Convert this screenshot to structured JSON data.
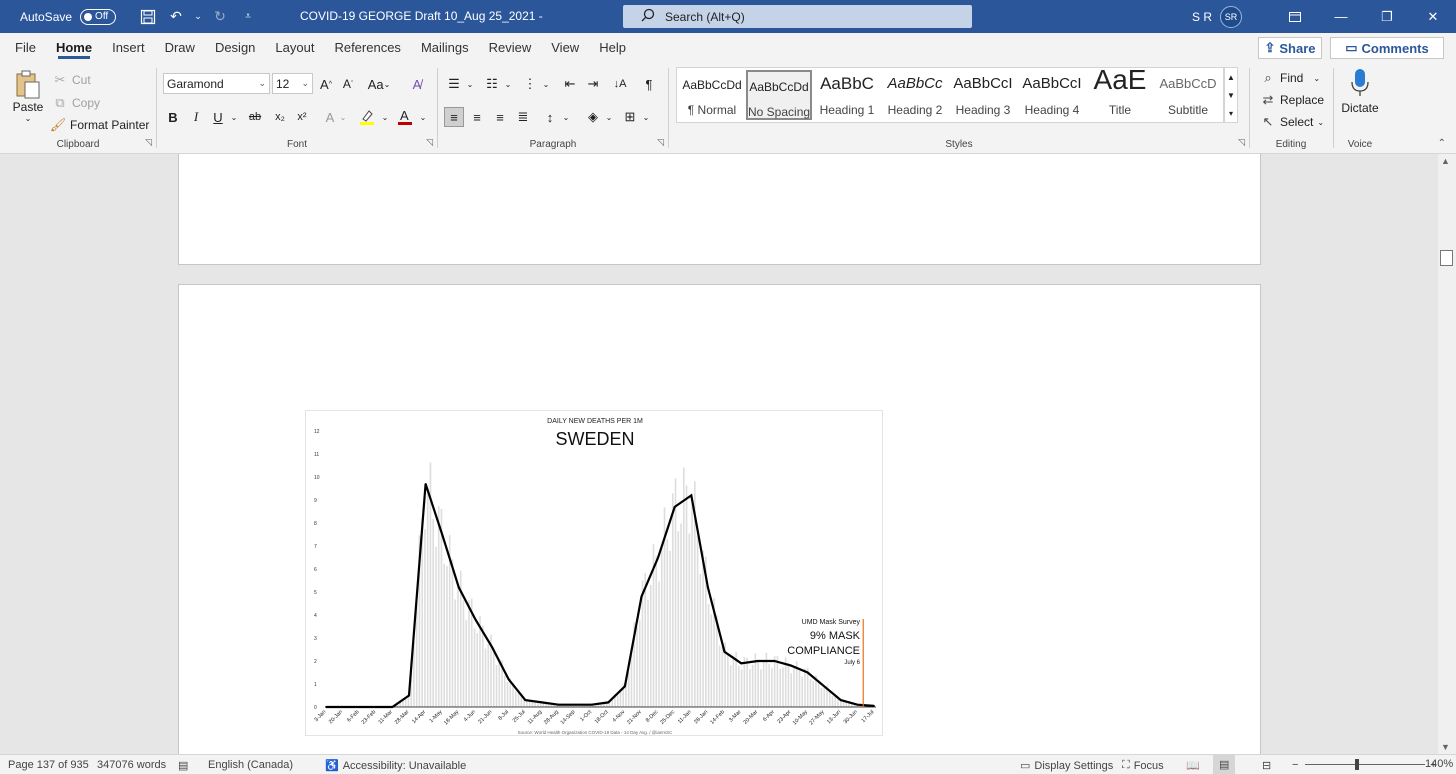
{
  "titlebar": {
    "autosave_label": "AutoSave",
    "autosave_state": "Off",
    "doc_title": "COVID-19 GEORGE Draft 10_Aug 25_2021  -  ",
    "search_placeholder": "Search (Alt+Q)",
    "user_initials_text": "S R",
    "avatar_text": "SR"
  },
  "tabs": [
    {
      "label": "File"
    },
    {
      "label": "Home"
    },
    {
      "label": "Insert"
    },
    {
      "label": "Draw"
    },
    {
      "label": "Design"
    },
    {
      "label": "Layout"
    },
    {
      "label": "References"
    },
    {
      "label": "Mailings"
    },
    {
      "label": "Review"
    },
    {
      "label": "View"
    },
    {
      "label": "Help"
    }
  ],
  "share_label": "Share",
  "comments_label": "Comments",
  "clipboard": {
    "paste": "Paste",
    "cut": "Cut",
    "copy": "Copy",
    "format_painter": "Format Painter",
    "group": "Clipboard"
  },
  "font": {
    "name": "Garamond",
    "size": "12",
    "group": "Font",
    "change_case": "Aa",
    "bold": "B",
    "italic": "I",
    "underline": "U",
    "strike": "ab",
    "subscript": "x₂",
    "superscript": "x²"
  },
  "paragraph": {
    "group": "Paragraph"
  },
  "styles": {
    "group": "Styles",
    "items": [
      {
        "preview": "AaBbCcDd",
        "name": "¶ Normal"
      },
      {
        "preview": "AaBbCcDd",
        "name": "No Spacing"
      },
      {
        "preview": "AaBbC",
        "name": "Heading 1"
      },
      {
        "preview": "AaBbCc",
        "name": "Heading 2"
      },
      {
        "preview": "AaBbCcI",
        "name": "Heading 3"
      },
      {
        "preview": "AaBbCcI",
        "name": "Heading 4"
      },
      {
        "preview": "AaE",
        "name": "Title"
      },
      {
        "preview": "AaBbCcD",
        "name": "Subtitle"
      }
    ]
  },
  "editing": {
    "find": "Find",
    "replace": "Replace",
    "select": "Select",
    "group": "Editing"
  },
  "voice": {
    "dictate": "Dictate",
    "group": "Voice"
  },
  "chart_data": {
    "type": "area",
    "subtitle": "DAILY NEW DEATHS PER 1M",
    "title": "SWEDEN",
    "ylim": [
      0,
      12
    ],
    "yticks": [
      "0",
      "1",
      "2",
      "3",
      "4",
      "5",
      "6",
      "7",
      "8",
      "9",
      "10",
      "11",
      "12"
    ],
    "categories": [
      "3-Jan",
      "20-Jan",
      "6-Feb",
      "23-Feb",
      "11-Mar",
      "28-Mar",
      "14-Apr",
      "1-May",
      "18-May",
      "4-Jun",
      "21-Jun",
      "8-Jul",
      "25-Jul",
      "11-Aug",
      "28-Aug",
      "14-Sep",
      "1-Oct",
      "18-Oct",
      "4-Nov",
      "21-Nov",
      "8-Dec",
      "25-Dec",
      "11-Jan",
      "28-Jan",
      "14-Feb",
      "3-Mar",
      "20-Mar",
      "6-Apr",
      "23-Apr",
      "10-May",
      "27-May",
      "13-Jun",
      "30-Jun",
      "17-Jul"
    ],
    "series": [
      {
        "values": [
          0,
          0,
          0,
          0,
          0,
          0.5,
          9.7,
          7.5,
          5.2,
          3.8,
          2.6,
          1.2,
          0.3,
          0.2,
          0.1,
          0.1,
          0.1,
          0.2,
          0.9,
          4.8,
          6.5,
          8.7,
          9.2,
          5.2,
          2.4,
          1.9,
          2.0,
          2.0,
          1.8,
          1.5,
          0.9,
          0.3,
          0.1,
          0.05
        ]
      }
    ],
    "annotation": {
      "x_category": "6-Jul",
      "lines": [
        "UMD Mask Survey",
        "9% MASK",
        "COMPLIANCE",
        "July 6"
      ]
    },
    "source": "Source: World Health Organization COVID-19 Data - 14 Day Avg. / @ianmSC",
    "colors": {
      "line": "#000000",
      "bars": "#dddddd",
      "marker": "#e8711a"
    }
  },
  "statusbar": {
    "page": "Page 137 of 935",
    "words": "347076 words",
    "language": "English (Canada)",
    "accessibility": "Accessibility: Unavailable",
    "display_settings": "Display Settings",
    "focus": "Focus",
    "zoom": "140%"
  }
}
